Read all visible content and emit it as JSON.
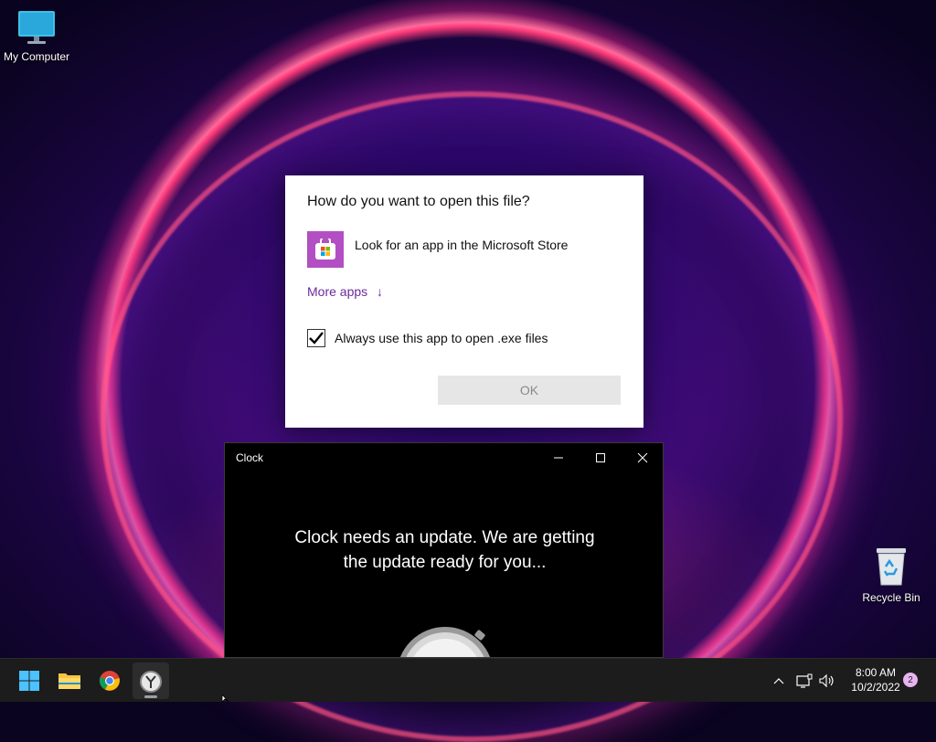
{
  "desktop": {
    "icons": [
      {
        "label": "My Computer"
      },
      {
        "label": "Recycle Bin"
      }
    ]
  },
  "open_with_dialog": {
    "title": "How do you want to open this file?",
    "store_option": "Look for an app in the Microsoft Store",
    "more_apps": "More apps",
    "more_apps_arrow": "↓",
    "always_use_label": "Always use this app to open .exe files",
    "always_use_checked": true,
    "ok_button": "OK"
  },
  "clock_window": {
    "title": "Clock",
    "message_line1": "Clock needs an update. We are getting",
    "message_line2": "the update ready for you..."
  },
  "taskbar": {
    "apps": [
      "windows-start-icon",
      "file-explorer-icon",
      "chrome-icon",
      "clock-app-icon"
    ],
    "time": "8:00 AM",
    "date": "10/2/2022",
    "notification_count": "2"
  },
  "colors": {
    "accent_purple": "#6a2a9c",
    "store_icon_bg": "#b24fc2",
    "taskbar_bg": "#1c1c1c"
  }
}
